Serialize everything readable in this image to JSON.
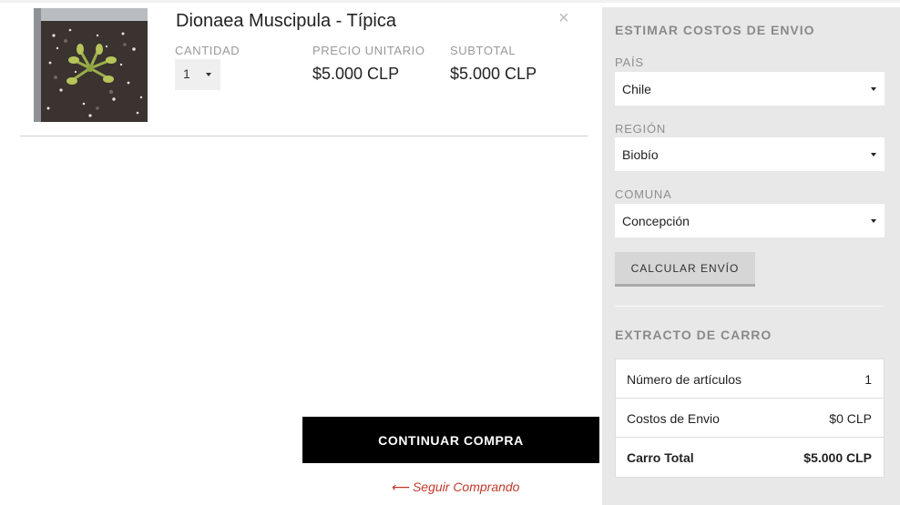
{
  "cart_item": {
    "image_alt": "Venus flytrap plant in soil",
    "title": "Dionaea Muscipula - Típica",
    "remove_icon": "×",
    "quantity_label": "CANTIDAD",
    "quantity_value": "1",
    "unit_price_label": "PRECIO UNITARIO",
    "unit_price": "$5.000 CLP",
    "subtotal_label": "SUBTOTAL",
    "subtotal": "$5.000 CLP"
  },
  "checkout": {
    "continue_label": "CONTINUAR COMPRA",
    "keep_shopping_label": "⟵ Seguir Comprando"
  },
  "shipping": {
    "heading": "ESTIMAR COSTOS DE ENVIO",
    "country_label": "PAÍS",
    "country_value": "Chile",
    "region_label": "REGIÓN",
    "region_value": "Biobío",
    "commune_label": "COMUNA",
    "commune_value": "Concepción",
    "calculate_label": "CALCULAR ENVÍO"
  },
  "summary": {
    "heading": "EXTRACTO DE CARRO",
    "rows": [
      {
        "label": "Número de artículos",
        "value": "1"
      },
      {
        "label": "Costos de Envio",
        "value": "$0 CLP"
      },
      {
        "label": "Carro Total",
        "value": "$5.000 CLP"
      }
    ]
  },
  "colors": {
    "checkout_button": "#000000",
    "keep_shopping_link": "#c0392b",
    "sidebar_bg": "#e8e8e8"
  }
}
